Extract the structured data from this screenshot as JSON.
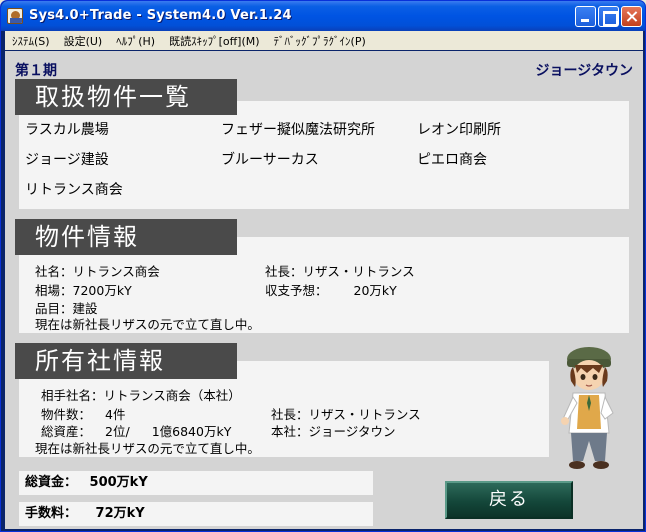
{
  "window": {
    "title": "Sys4.0+Trade - System4.0 Ver.1.24"
  },
  "menu": [
    "ｼｽﾃﾑ(S)",
    "設定(U)",
    "ﾍﾙﾌﾟ(H)",
    "既読ｽｷｯﾌﾟ[off](M)",
    "ﾃﾞﾊﾞｯｸﾞﾌﾟﾗｸﾞｲﾝ(P)"
  ],
  "header": {
    "period": "第１期",
    "location": "ジョージタウン"
  },
  "properties": {
    "title": "取扱物件一覧",
    "items": [
      "ラスカル農場",
      "フェザー擬似魔法研究所",
      "レオン印刷所",
      "ジョージ建設",
      "ブルーサーカス",
      "ピエロ商会",
      "リトランス商会"
    ]
  },
  "property_info": {
    "title": "物件情報",
    "company_label": "社名：",
    "company": "リトランス商会",
    "president_label": "社長：",
    "president": "リザス・リトランス",
    "price_label": "相場：",
    "price": "7200万kY",
    "forecast_label": "収支予想：",
    "forecast": "20万kY",
    "category_label": "品目：",
    "category": "建設",
    "note": "現在は新社長リザスの元で立て直し中。"
  },
  "owner_info": {
    "title": "所有社情報",
    "partner_label": "相手社名：",
    "partner": "リトランス商会（本社）",
    "count_label": "物件数：",
    "count": "4件",
    "president_label": "社長：",
    "president": "リザス・リトランス",
    "assets_label": "総資産：",
    "assets_rank": "2位/",
    "assets": "1億6840万kY",
    "hq_label": "本社：",
    "hq": "ジョージタウン",
    "note": "現在は新社長リザスの元で立て直し中。"
  },
  "funds": {
    "label": "総資金：",
    "value": "500万kY"
  },
  "fee": {
    "label": "手数料：",
    "value": "72万kY"
  },
  "back_button": {
    "label": "戻る"
  },
  "colors": {
    "titlebar": "#0054e3",
    "section_tab": "#4a4a4a",
    "panel": "#f4f4f4",
    "back_button": "#14473a",
    "header_text": "#0a1060"
  }
}
